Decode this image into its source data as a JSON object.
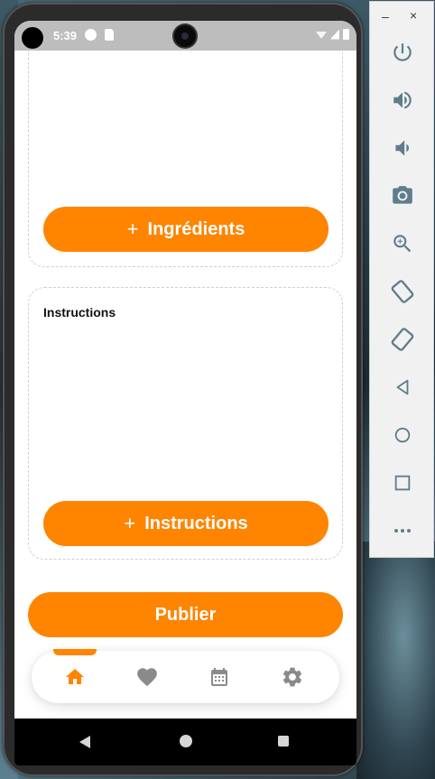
{
  "status_bar": {
    "time": "5:39"
  },
  "cards": {
    "ingredients_button_label": "Ingrédients",
    "instructions_title": "Instructions",
    "instructions_button_label": "Instructions"
  },
  "publish_label": "Publier",
  "bottom_nav": {
    "items": [
      {
        "icon": "home-icon",
        "active": true
      },
      {
        "icon": "heart-icon",
        "active": false
      },
      {
        "icon": "calendar-icon",
        "active": false
      },
      {
        "icon": "settings-icon",
        "active": false
      }
    ]
  },
  "emulator_toolbar": {
    "minimize": "–",
    "close": "×",
    "buttons": [
      "power-icon",
      "volume-up-icon",
      "volume-down-icon",
      "camera-icon",
      "zoom-icon",
      "rotate-left-icon",
      "rotate-right-icon",
      "back-icon",
      "home-icon",
      "overview-icon",
      "more-icon"
    ]
  },
  "colors": {
    "accent": "#ff8400",
    "nav_inactive": "#8a8a8a",
    "toolbar_icon": "#5f7d8d"
  }
}
